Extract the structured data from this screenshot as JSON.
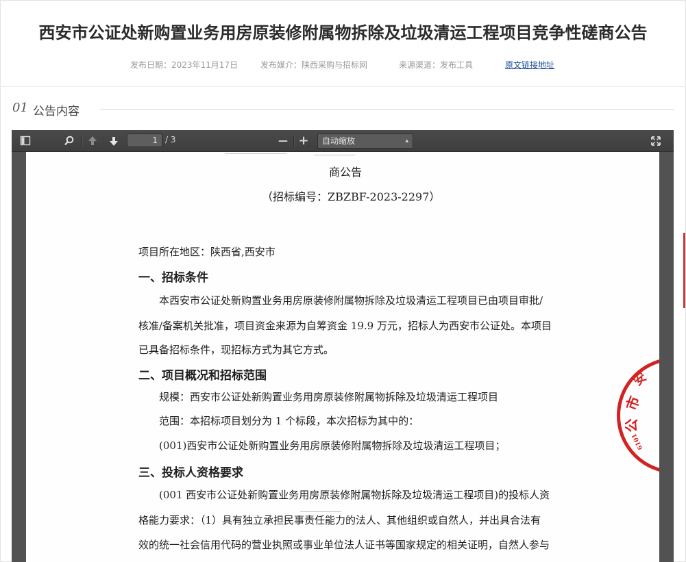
{
  "page": {
    "title": "西安市公证处新购置业务用房原装修附属物拆除及垃圾清运工程项目竞争性磋商公告",
    "meta": {
      "publish_date": "发布日期：2023年11月17日",
      "publish_media": "发布媒介：陕西采购与招标网",
      "source_channel": "来源渠道：发布工具",
      "original_link": "原文链接地址"
    },
    "section": {
      "number": "01",
      "label": "公告内容"
    }
  },
  "viewer": {
    "toolbar": {
      "sidebar_icon": "sidebar-toggle-icon",
      "search_icon": "search-icon",
      "prev_icon": "arrow-up-icon",
      "next_icon": "arrow-down-icon",
      "page_number": "1",
      "page_count": "/ 3",
      "zoom_out": "—",
      "zoom_in": "+",
      "zoom_value": "自动缩放",
      "fullscreen_icon": "fullscreen-icon"
    },
    "document": {
      "heading": "商公告",
      "bid_number": "（招标编号：ZBZBF-2023-2297）",
      "location": "项目所在地区：陕西省,西安市",
      "s1_title": "一、招标条件",
      "s1_p1": "本西安市公证处新购置业务用房原装修附属物拆除及垃圾清运工程项目已由项目审批/",
      "s1_p2": "核准/备案机关批准，项目资金来源为自筹资金 19.9 万元，招标人为西安市公证处。本项目",
      "s1_p3": "已具备招标条件，现招标方式为其它方式。",
      "s2_title": "二、项目概况和招标范围",
      "s2_scale": "规模：西安市公证处新购置业务用房原装修附属物拆除及垃圾清运工程项目",
      "s2_scope": "范围：本招标项目划分为 1 个标段，本次招标为其中的：",
      "s2_item": "(001)西安市公证处新购置业务用房原装修附属物拆除及垃圾清运工程项目；",
      "s3_title": "三、投标人资格要求",
      "s3_p1": "(001 西安市公证处新购置业务用房原装修附属物拆除及垃圾清运工程项目)的投标人资",
      "s3_p2": "格能力要求：（1）具有独立承担民事责任能力的法人、其他组织或自然人，并出具合法有",
      "s3_p3": "效的统一社会信用代码的营业执照或事业单位法人证书等国家规定的相关证明，自然人参与"
    }
  },
  "colors": {
    "link": "#1f4e9e",
    "seal_red": "#d32222",
    "viewer_bg": "#525252"
  }
}
